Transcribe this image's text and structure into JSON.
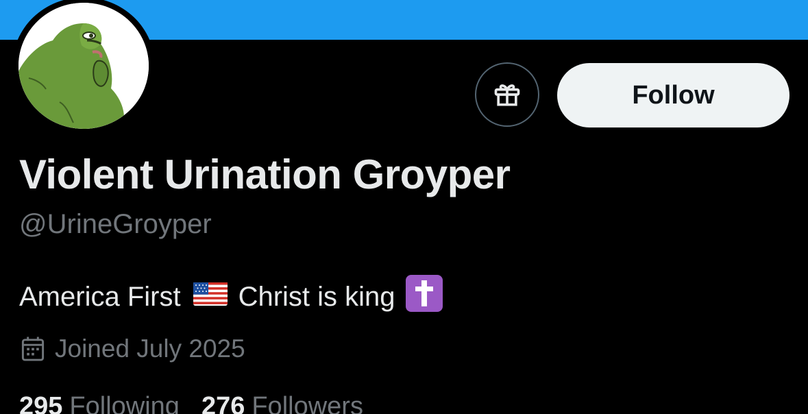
{
  "profile": {
    "display_name": "Violent Urination Groyper",
    "handle": "@UrineGroyper",
    "bio": {
      "part1": "America First",
      "flag_emoji": "🇺🇸",
      "part2": "Christ is king",
      "cross_emoji": "✝️"
    },
    "joined": "Joined July 2025",
    "following_count": "295",
    "following_label": "Following",
    "followers_count": "276",
    "followers_label": "Followers"
  },
  "actions": {
    "follow_label": "Follow",
    "gift_icon": "gift-icon"
  },
  "colors": {
    "banner": "#1d9bf0",
    "background": "#000000",
    "primary_text": "#e7e9ea",
    "secondary_text": "#71767b",
    "follow_button_bg": "#eff3f4",
    "avatar_frog": "#6a9a3a"
  }
}
